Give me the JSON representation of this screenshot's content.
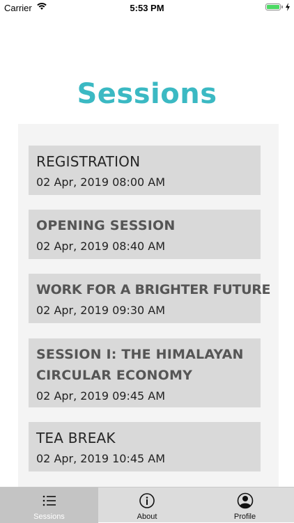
{
  "status_bar": {
    "carrier": "Carrier",
    "time": "5:53 PM",
    "battery_color": "#4cd964"
  },
  "page": {
    "title": "Sessions",
    "title_color": "#3bb9c3"
  },
  "sessions": [
    {
      "name": "REGISTRATION",
      "datetime": "02 Apr, 2019 08:00 AM"
    },
    {
      "name": "OPENING SESSION",
      "datetime": "02 Apr, 2019 08:40 AM"
    },
    {
      "name": "WORK FOR A BRIGHTER FUTURE",
      "datetime": "02 Apr, 2019 09:30 AM"
    },
    {
      "name": "SESSION I: THE HIMALAYAN CIRCULAR ECONOMY",
      "datetime": "02 Apr, 2019 09:45 AM"
    },
    {
      "name": "TEA BREAK",
      "datetime": "02 Apr, 2019 10:45 AM"
    }
  ],
  "tab_bar": {
    "tabs": [
      {
        "label": "Sessions",
        "icon": "list-icon",
        "active": true
      },
      {
        "label": "About",
        "icon": "info-icon",
        "active": false
      },
      {
        "label": "Profile",
        "icon": "profile-icon",
        "active": false
      }
    ]
  }
}
